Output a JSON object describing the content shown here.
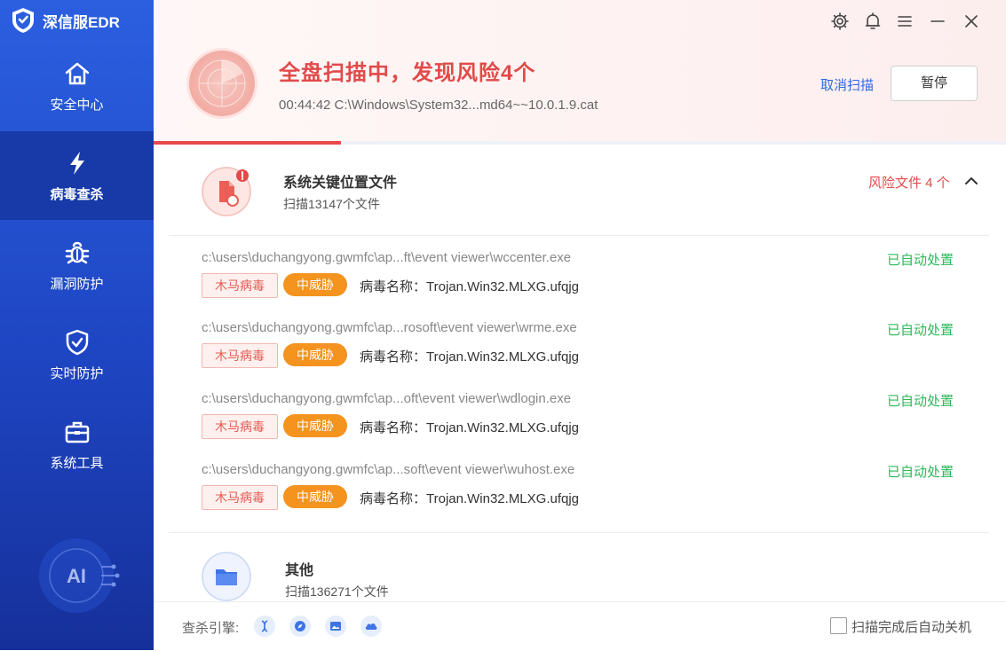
{
  "app": {
    "brand": "深信服EDR"
  },
  "sidebar": {
    "items": [
      {
        "label": "安全中心",
        "icon": "home-icon"
      },
      {
        "label": "病毒查杀",
        "icon": "lightning-icon",
        "active": true
      },
      {
        "label": "漏洞防护",
        "icon": "bug-icon"
      },
      {
        "label": "实时防护",
        "icon": "shield-check-icon"
      },
      {
        "label": "系统工具",
        "icon": "toolbox-icon"
      }
    ],
    "ai_label": "AI"
  },
  "window_controls": [
    "gear-icon",
    "bell-icon",
    "menu-icon",
    "minimize-icon",
    "close-icon"
  ],
  "scan": {
    "title": "全盘扫描中，发现风险4个",
    "current": "00:44:42  C:\\Windows\\System32...md64~~10.0.1.9.cat",
    "cancel_label": "取消扫描",
    "pause_label": "暂停",
    "progress": 0.22
  },
  "groups": [
    {
      "title": "系统关键位置文件",
      "subtitle": "扫描13147个文件",
      "risk_label": "风险文件 4 个",
      "items": [
        {
          "path": "c:\\users\\duchangyong.gwmfc\\ap...ft\\event viewer\\wccenter.exe",
          "tag": "木马病毒",
          "level": "中威胁",
          "virus": "病毒名称：Trojan.Win32.MLXG.ufqjg",
          "status": "已自动处置"
        },
        {
          "path": "c:\\users\\duchangyong.gwmfc\\ap...rosoft\\event viewer\\wrme.exe",
          "tag": "木马病毒",
          "level": "中威胁",
          "virus": "病毒名称：Trojan.Win32.MLXG.ufqjg",
          "status": "已自动处置"
        },
        {
          "path": "c:\\users\\duchangyong.gwmfc\\ap...oft\\event viewer\\wdlogin.exe",
          "tag": "木马病毒",
          "level": "中威胁",
          "virus": "病毒名称：Trojan.Win32.MLXG.ufqjg",
          "status": "已自动处置"
        },
        {
          "path": "c:\\users\\duchangyong.gwmfc\\ap...soft\\event viewer\\wuhost.exe",
          "tag": "木马病毒",
          "level": "中威胁",
          "virus": "病毒名称：Trojan.Win32.MLXG.ufqjg",
          "status": "已自动处置"
        }
      ]
    },
    {
      "title": "其他",
      "subtitle": "扫描136271个文件"
    }
  ],
  "footer": {
    "engine_label": "查杀引擎:",
    "engines": [
      "gene-engine-icon",
      "compass-engine-icon",
      "image-engine-icon",
      "cloud-engine-icon"
    ],
    "shutdown_label": "扫描完成后自动关机"
  },
  "colors": {
    "sidebar": "#1e45c2",
    "danger": "#e24a4a",
    "ok": "#2db85a",
    "threat": "#f4931d",
    "link": "#2b6ae0"
  }
}
